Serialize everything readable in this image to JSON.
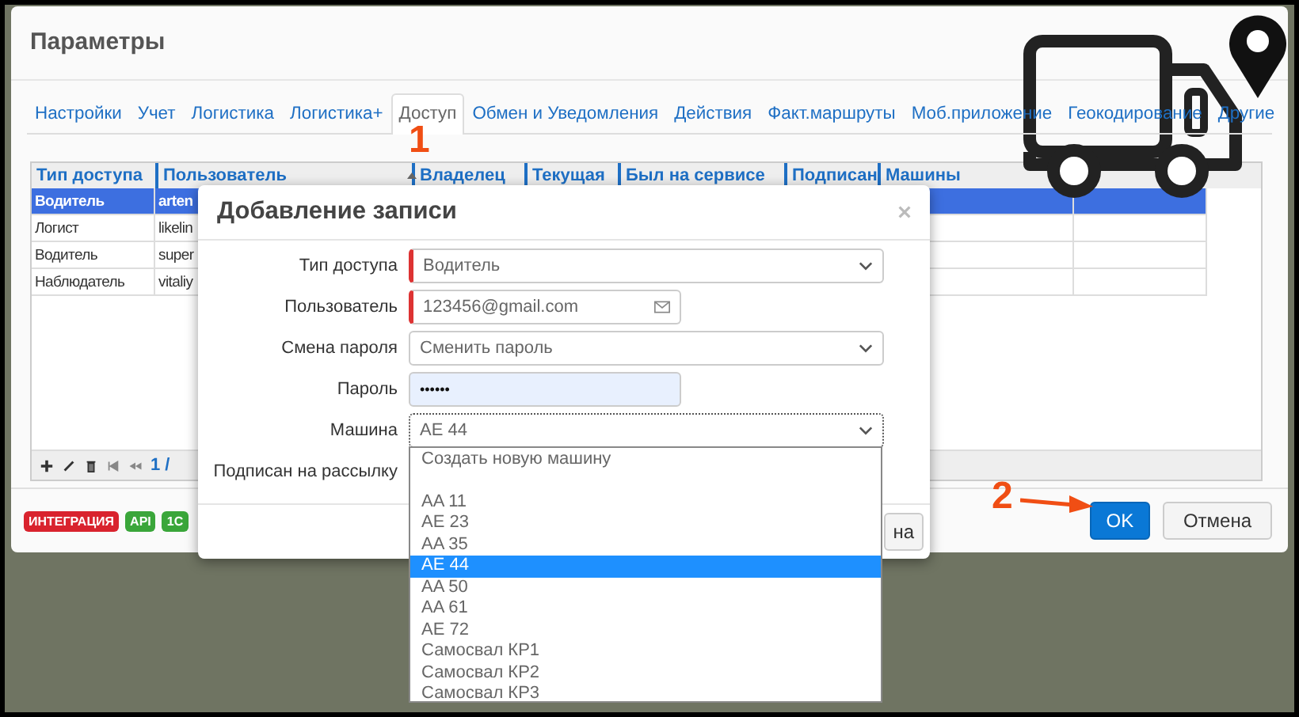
{
  "window": {
    "title": "Параметры"
  },
  "tabs": [
    {
      "label": "Настройки",
      "selected": false
    },
    {
      "label": "Учет",
      "selected": false
    },
    {
      "label": "Логистика",
      "selected": false
    },
    {
      "label": "Логистика+",
      "selected": false
    },
    {
      "label": "Доступ",
      "selected": true
    },
    {
      "label": "Обмен и Уведомления",
      "selected": false
    },
    {
      "label": "Действия",
      "selected": false
    },
    {
      "label": "Факт.маршруты",
      "selected": false
    },
    {
      "label": "Моб.приложение",
      "selected": false
    },
    {
      "label": "Геокодирование",
      "selected": false
    },
    {
      "label": "Другие",
      "selected": false
    }
  ],
  "table": {
    "columns": [
      "Тип доступа",
      "Пользователь",
      "Владелец",
      "Текущая",
      "Был на сервисе",
      "Подписан",
      "Машины"
    ],
    "rows": [
      {
        "cells": [
          "Водитель",
          "arten"
        ],
        "selected": true
      },
      {
        "cells": [
          "Логист",
          "likelin"
        ],
        "selected": false
      },
      {
        "cells": [
          "Водитель",
          "super"
        ],
        "selected": false
      },
      {
        "cells": [
          "Наблюдатель",
          "vitaliy"
        ],
        "selected": false
      }
    ]
  },
  "pager": {
    "page": "1 /"
  },
  "badges": [
    {
      "label": "ИНТЕГРАЦИЯ",
      "color": "#d9232e"
    },
    {
      "label": "API",
      "color": "#3aa63a"
    },
    {
      "label": "1С",
      "color": "#3aa63a"
    }
  ],
  "buttons": [
    {
      "label": "OK",
      "kind": "primary"
    },
    {
      "label": "Отмена",
      "kind": "default"
    }
  ],
  "dialog": {
    "title": "Добавление записи",
    "fields": [
      {
        "label": "Тип доступа",
        "kind": "select",
        "value": "Водитель",
        "required": true
      },
      {
        "label": "Пользователь",
        "kind": "email",
        "value": "123456@gmail.com",
        "required": true
      },
      {
        "label": "Смена пароля",
        "kind": "select",
        "value": "Сменить пароль",
        "required": false
      },
      {
        "label": "Пароль",
        "kind": "password",
        "value": "••••••",
        "required": false
      },
      {
        "label": "Машина",
        "kind": "select",
        "value": "AE 44",
        "required": false
      },
      {
        "label": "Подписан на рассылку",
        "kind": "hidden"
      }
    ],
    "footer_button": "на"
  },
  "dropdown": {
    "options": [
      {
        "label": "Создать новую машину",
        "kind": "action",
        "selected": false
      },
      {
        "label": "AA 11",
        "kind": "vehicle",
        "selected": false
      },
      {
        "label": "AE 23",
        "kind": "vehicle",
        "selected": false
      },
      {
        "label": "AA 35",
        "kind": "vehicle",
        "selected": false
      },
      {
        "label": "AE 44",
        "kind": "vehicle",
        "selected": true
      },
      {
        "label": "AA 50",
        "kind": "vehicle",
        "selected": false
      },
      {
        "label": "AA 61",
        "kind": "vehicle",
        "selected": false
      },
      {
        "label": "AE 72",
        "kind": "vehicle",
        "selected": false
      },
      {
        "label": "Самосвал КР1",
        "kind": "vehicle",
        "selected": false
      },
      {
        "label": "Самосвал КР2",
        "kind": "vehicle",
        "selected": false
      },
      {
        "label": "Самосвал КР3",
        "kind": "vehicle",
        "selected": false
      }
    ]
  },
  "annotations": [
    {
      "label": "1"
    },
    {
      "label": "2"
    }
  ]
}
